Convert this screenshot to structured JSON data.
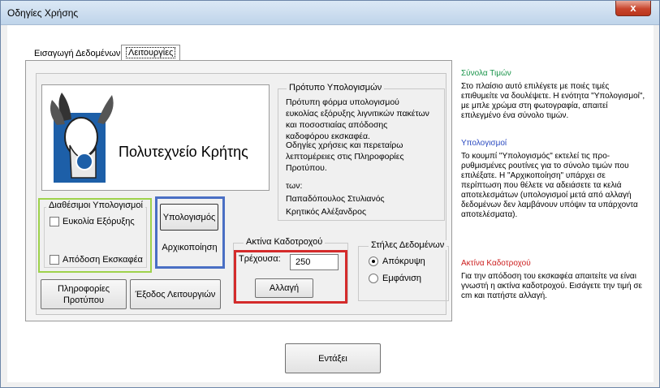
{
  "window": {
    "title": "Οδηγίες Χρήσης",
    "close_glyph": "x"
  },
  "tabs": [
    {
      "label": "Εισαγωγή Δεδομένων",
      "active": false
    },
    {
      "label": "Λειτουργίες",
      "active": true
    }
  ],
  "logo": {
    "text": "Πολυτεχνείο Κρήτης"
  },
  "template_info": {
    "legend": "Πρότυπο Υπολογισμών",
    "description": "Πρότυπη φόρμα υπολογισμού ευκολίας εξόρυξης λιγνιτικών πακέτων και ποσοστιαίας απόδοσης καδοφόρου εκσκαφέα.",
    "details": "Οδηγίες χρήσεις και περεταίρω λεπτομέρειες στις Πληροφορίες Προτύπου.",
    "authors_label": "των:",
    "author1": "Παπαδόπουλος Στυλιανός",
    "author2": "Κρητικός Αλέξανδρος"
  },
  "available_calcs": {
    "legend": "Διαθέσιμοι Υπολογισμοί",
    "items": [
      {
        "label": "Ευκολία Εξόρυξης",
        "checked": false
      },
      {
        "label": "Απόδοση Εκσκαφέα",
        "checked": false
      }
    ]
  },
  "buttons": {
    "calculations": "Υπολογισμός",
    "reset": "Αρχικοποίηση",
    "template_info": "Πληροφορίες Προτύπου",
    "exit_functions": "Έξοδος Λειτουργιών",
    "change": "Αλλαγή",
    "ok": "Εντάξει"
  },
  "wheel_radius": {
    "legend": "Ακτίνα Καδοτροχού",
    "current_label": "Τρέχουσα:",
    "current_value": "250"
  },
  "data_columns": {
    "legend": "Στήλες Δεδομένων",
    "options": [
      {
        "label": "Απόκρυψη",
        "selected": true
      },
      {
        "label": "Εμφάνιση",
        "selected": false
      }
    ]
  },
  "help": {
    "sets_title": "Σύνολα Τιμών",
    "sets_text": "Στο πλαίσιο αυτό επιλέγετε με ποιές τιμές επιθυμείτε να δουλέψετε. Η ενότητα \"Υπολογισμοί\", με μπλε χρώμα στη φωτογραφία, απαιτεί επιλεγμένο ένα σύνολο τιμών.",
    "calcs_title": "Υπολογισμοί",
    "calcs_text": "Το κουμπί \"Υπολογισμός\" εκτελεί τις προ-ρυθμισμένες ρουτίνες για το σύνολο τιμών που επιλέξατε. Η \"Αρχικοποίηση\" υπάρχει σε περίπτωση που θέλετε να αδειάσετε τα κελιά αποτελεσμάτων (υπολογισμοί μετά από αλλαγή δεδομένων δεν λαμβάνουν υπόψιν τα υπάρχοντα αποτελέσματα).",
    "radius_title": "Ακτίνα Καδοτροχού",
    "radius_text": "Για την απόδοση του εκσκαφέα απαιτείτε να είναι γνωστή η ακτίνα καδοτροχού. Εισάγετε την τιμή σε cm και πατήστε αλλαγή."
  }
}
